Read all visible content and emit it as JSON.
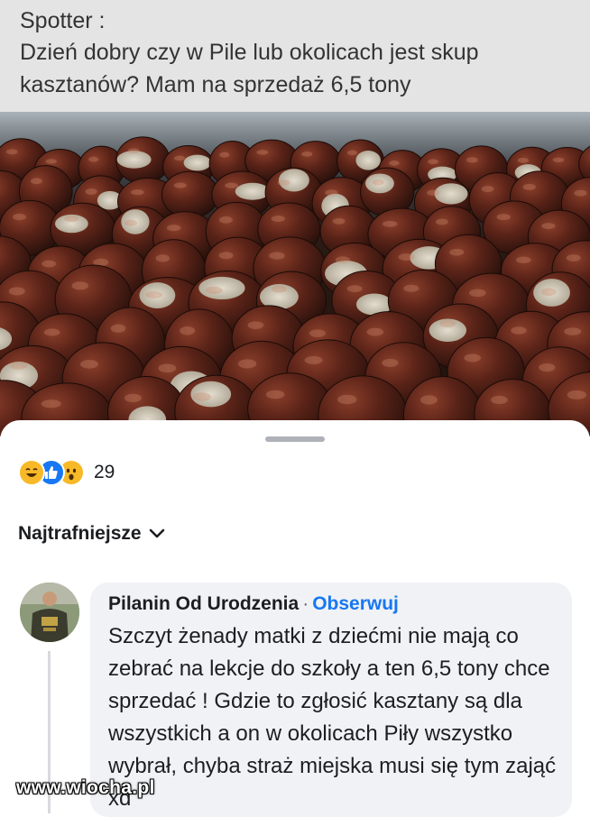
{
  "post": {
    "author": "Spotter :",
    "text": "Dzień dobry czy w Pile lub okolicach jest skup kasztanów? Mam na sprzedaż 6,5 tony"
  },
  "photo": {
    "icon": "chestnuts-photo"
  },
  "reactions": {
    "icons": [
      "haha-icon",
      "like-icon",
      "wow-icon"
    ],
    "count": "29"
  },
  "sort": {
    "label": "Najtrafniejsze"
  },
  "comment": {
    "author": "Pilanin Od Urodzenia",
    "separator": "·",
    "follow_label": "Obserwuj",
    "text": "Szczyt żenady matki z dziećmi nie mają co zebrać na lekcje do szkoły a ten 6,5 tony chce sprzedać ! Gdzie to zgłosić kasztany są dla wszystkich a on w okolicach Piły wszystko wybrał, chyba straż miejska musi się tym zająć xd"
  },
  "watermark": "www.wiocha.pl",
  "colors": {
    "link": "#1877f2",
    "bubble": "#f0f2f5",
    "header_bg": "#e4e4e4"
  }
}
